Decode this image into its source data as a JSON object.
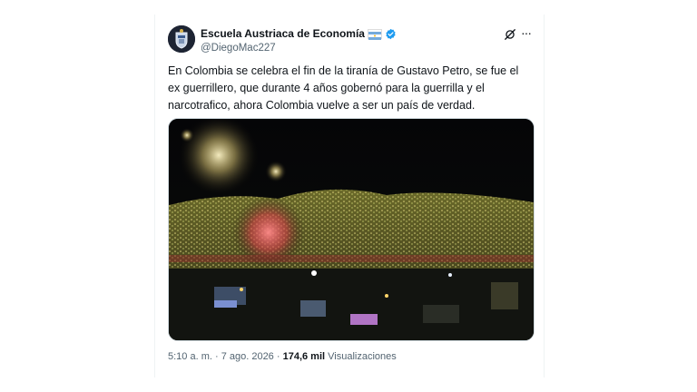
{
  "author": {
    "display_name": "Escuela Austriaca de Economía",
    "handle": "@DiegoMac227",
    "flag_icon": "argentina-flag-icon",
    "verified_icon": "verified-badge-icon",
    "verified_color": "#1d9bf0"
  },
  "tweet": {
    "text": "En Colombia se celebra el fin de la tiranía de Gustavo Petro, se fue el ex guerrillero, que durante 4 años gobernó para la guerrilla y el narcotrafico, ahora Colombia vuelve a ser un país de verdad."
  },
  "actions": {
    "grok_icon": "grok-icon",
    "more_icon": "more-options-icon"
  },
  "metadata": {
    "timestamp": "5:10 a. m. · 7 ago. 2026",
    "separator": " · ",
    "views_count": "174,6 mil",
    "views_label": "Visualizaciones"
  },
  "colors": {
    "text_primary": "#0f1419",
    "text_secondary": "#536471",
    "border": "#cfd9de"
  }
}
